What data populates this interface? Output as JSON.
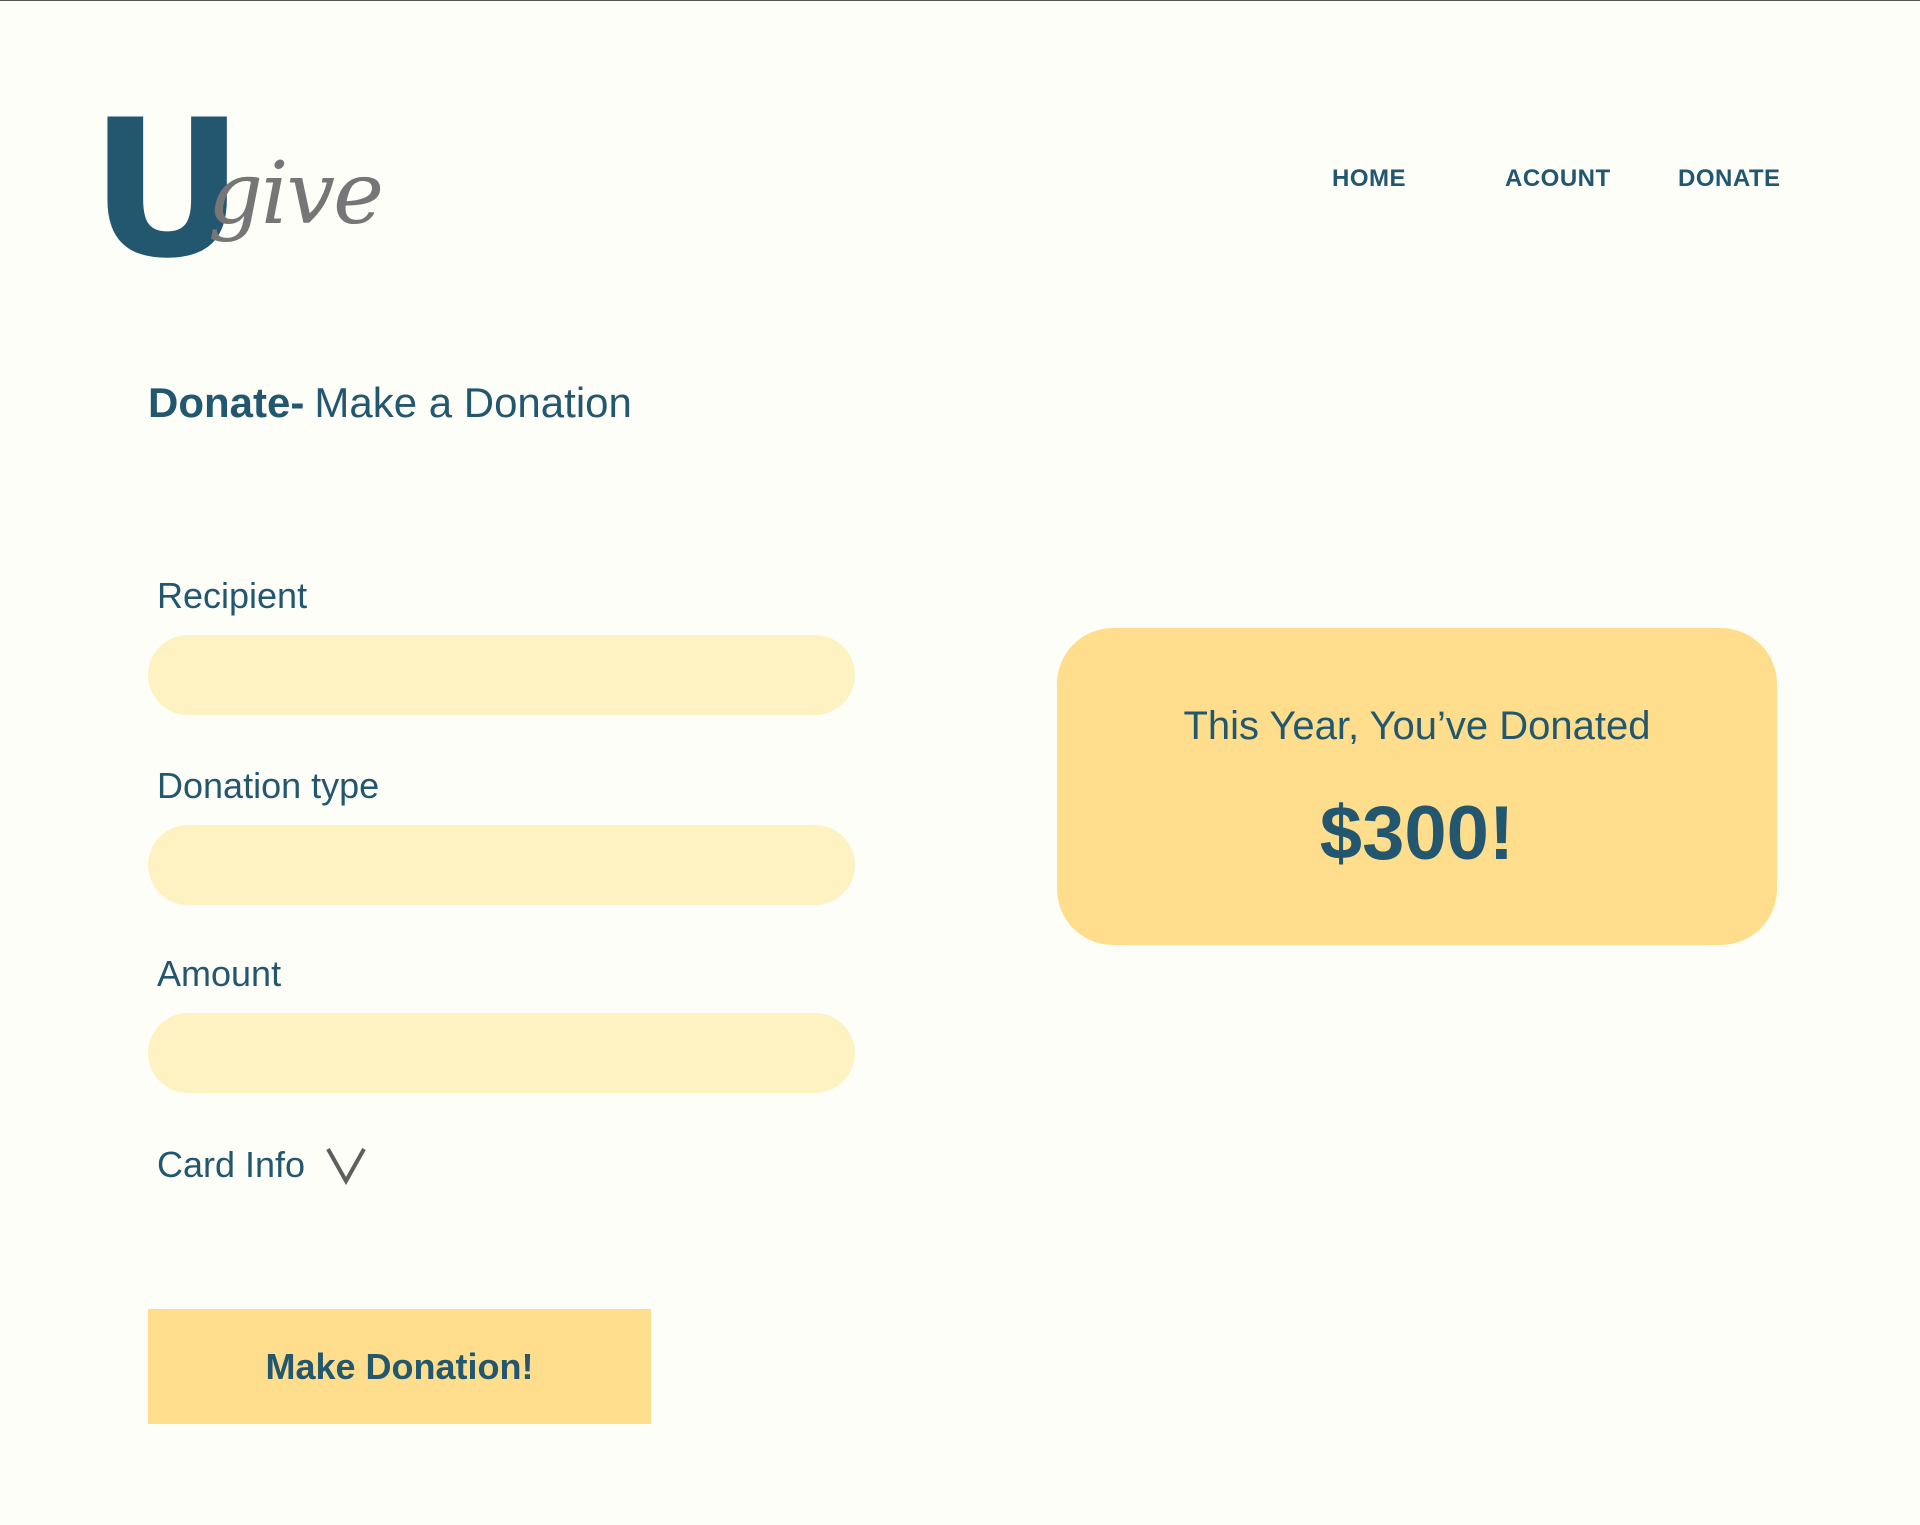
{
  "brand": {
    "logo_letter": "U",
    "logo_word": "give"
  },
  "nav": {
    "items": [
      {
        "label": "HOME"
      },
      {
        "label": "ACOUNT"
      },
      {
        "label": "DONATE"
      }
    ]
  },
  "page": {
    "title_bold": "Donate-",
    "title_rest": "Make a Donation"
  },
  "form": {
    "recipient": {
      "label": "Recipient",
      "value": "",
      "placeholder": ""
    },
    "donation_type": {
      "label": "Donation type",
      "value": "",
      "placeholder": ""
    },
    "amount": {
      "label": "Amount",
      "value": "",
      "placeholder": ""
    },
    "card_info": {
      "label": "Card Info",
      "icon": "chevron-down-icon"
    },
    "submit_label": "Make Donation!"
  },
  "summary": {
    "caption": "This Year, You’ve Donated",
    "amount": "$300!"
  },
  "colors": {
    "primary": "#22576f",
    "accent": "#fede8c",
    "input_fill": "#fef2c3",
    "background": "#fefef8",
    "logo_secondary": "#767676"
  }
}
